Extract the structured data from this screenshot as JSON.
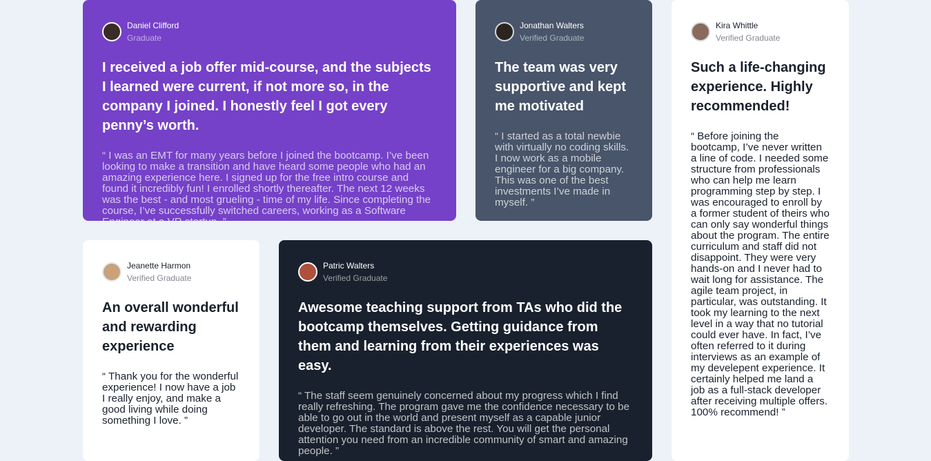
{
  "testimonials": [
    {
      "name": "Daniel Clifford",
      "role": "Graduate",
      "avatar_color": "#3a2c28",
      "avatar_ring": "#ffffff",
      "headline": "I received a job offer mid-course, and the subjects I learned were current, if not more so, in the company I joined. I honestly feel I got every penny’s worth.",
      "quote": "“ I was an EMT for many years before I joined the bootcamp. I’ve been looking to make a transition and have heard some people who had an amazing experience here. I signed up for the free intro course and found it incredibly fun! I enrolled shortly thereafter. The next 12 weeks was the best - and most grueling - time of my life. Since completing the course, I’ve successfully switched careers, working as a Software Engineer at a VR startup. ”"
    },
    {
      "name": "Jonathan Walters",
      "role": "Verified Graduate",
      "avatar_color": "#2b2421",
      "avatar_ring": "#d5d9df",
      "headline": "The team was very supportive and kept me motivated",
      "quote": "“ I started as a total newbie with virtually no coding skills. I now work as a mobile engineer for a big company. This was one of the best investments I’ve made in myself. ”"
    },
    {
      "name": "Kira Whittle",
      "role": "Verified Graduate",
      "avatar_color": "#8a6a5a",
      "avatar_ring": "#d5d9df",
      "headline": "Such a life-changing experience. Highly recommended!",
      "quote": "“ Before joining the bootcamp, I’ve never written a line of code. I needed some structure from professionals who can help me learn programming step by step. I was encouraged to enroll by a former student of theirs who can only say wonderful things about the program. The entire curriculum and staff did not disappoint. They were very hands-on and I never had to wait long for assistance. The agile team project, in particular, was outstanding. It took my learning to the next level in a way that no tutorial could ever have. In fact, I’ve often referred to it during interviews as an example of my develepent experience. It certainly helped me land a job as a full-stack developer after receiving multiple offers. 100% recommend! ”"
    },
    {
      "name": "Jeanette Harmon",
      "role": "Verified Graduate",
      "avatar_color": "#c9a27a",
      "avatar_ring": "#e6e8ec",
      "headline": "An overall wonderful and rewarding experience",
      "quote": "“ Thank you for the wonderful experience! I now have a job I really enjoy, and make a good living while doing something I love. ”"
    },
    {
      "name": "Patric Walters",
      "role": "Verified Graduate",
      "avatar_color": "#b0503c",
      "avatar_ring": "#ffffff",
      "headline": "Awesome teaching support from TAs who did the bootcamp themselves. Getting guidance from them and learning from their experiences was easy.",
      "quote": "“ The staff seem genuinely concerned about my progress which I find really refreshing. The program gave me the confidence necessary to be able to go out in the world and present myself as a capable junior developer. The standard is above the rest. You will get the personal attention you need from an incredible community of smart and amazing people. ”"
    }
  ]
}
